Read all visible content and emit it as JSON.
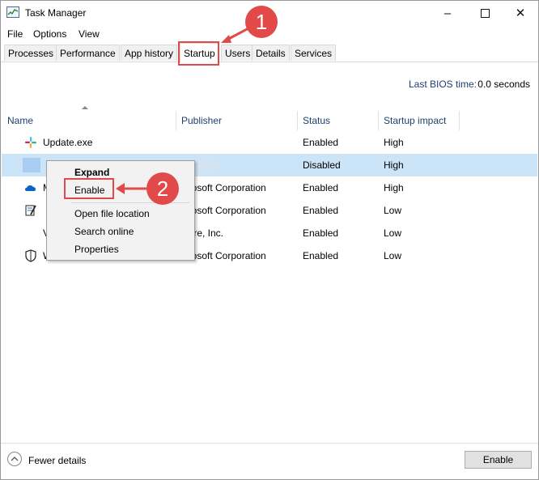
{
  "window": {
    "title": "Task Manager"
  },
  "menu": [
    "File",
    "Options",
    "View"
  ],
  "tabs": [
    {
      "label": "Processes"
    },
    {
      "label": "Performance"
    },
    {
      "label": "App history"
    },
    {
      "label": "Startup",
      "active": true
    },
    {
      "label": "Users"
    },
    {
      "label": "Details"
    },
    {
      "label": "Services"
    }
  ],
  "bios": {
    "label": "Last BIOS time:",
    "value": "0.0 seconds"
  },
  "columns": {
    "name": "Name",
    "publisher": "Publisher",
    "status": "Status",
    "impact": "Startup impact"
  },
  "rows": [
    {
      "name": "Update.exe",
      "publisher": "",
      "status": "Enabled",
      "impact": "High",
      "icon": "slack-icon"
    },
    {
      "name": "",
      "publisher": "",
      "status": "Disabled",
      "impact": "High",
      "icon": "app-icon",
      "selected": true
    },
    {
      "name": "M",
      "publisher": "icrosoft Corporation",
      "status": "Enabled",
      "impact": "High",
      "icon": "onedrive-icon"
    },
    {
      "name": "",
      "publisher": "icrosoft Corporation",
      "status": "Enabled",
      "impact": "Low",
      "icon": "notepad-icon"
    },
    {
      "name": "V",
      "publisher": "ware, Inc.",
      "status": "Enabled",
      "impact": "Low",
      "icon": "none"
    },
    {
      "name": "W",
      "publisher": "icrosoft Corporation",
      "status": "Enabled",
      "impact": "Low",
      "icon": "shield-icon"
    }
  ],
  "context_menu": {
    "expand": "Expand",
    "enable": "Enable",
    "open_file_location": "Open file location",
    "search_online": "Search online",
    "properties": "Properties"
  },
  "annotations": {
    "step1": "1",
    "step2": "2",
    "color": "#e24a4a"
  },
  "footer": {
    "fewer_details": "Fewer details",
    "enable_button": "Enable"
  }
}
